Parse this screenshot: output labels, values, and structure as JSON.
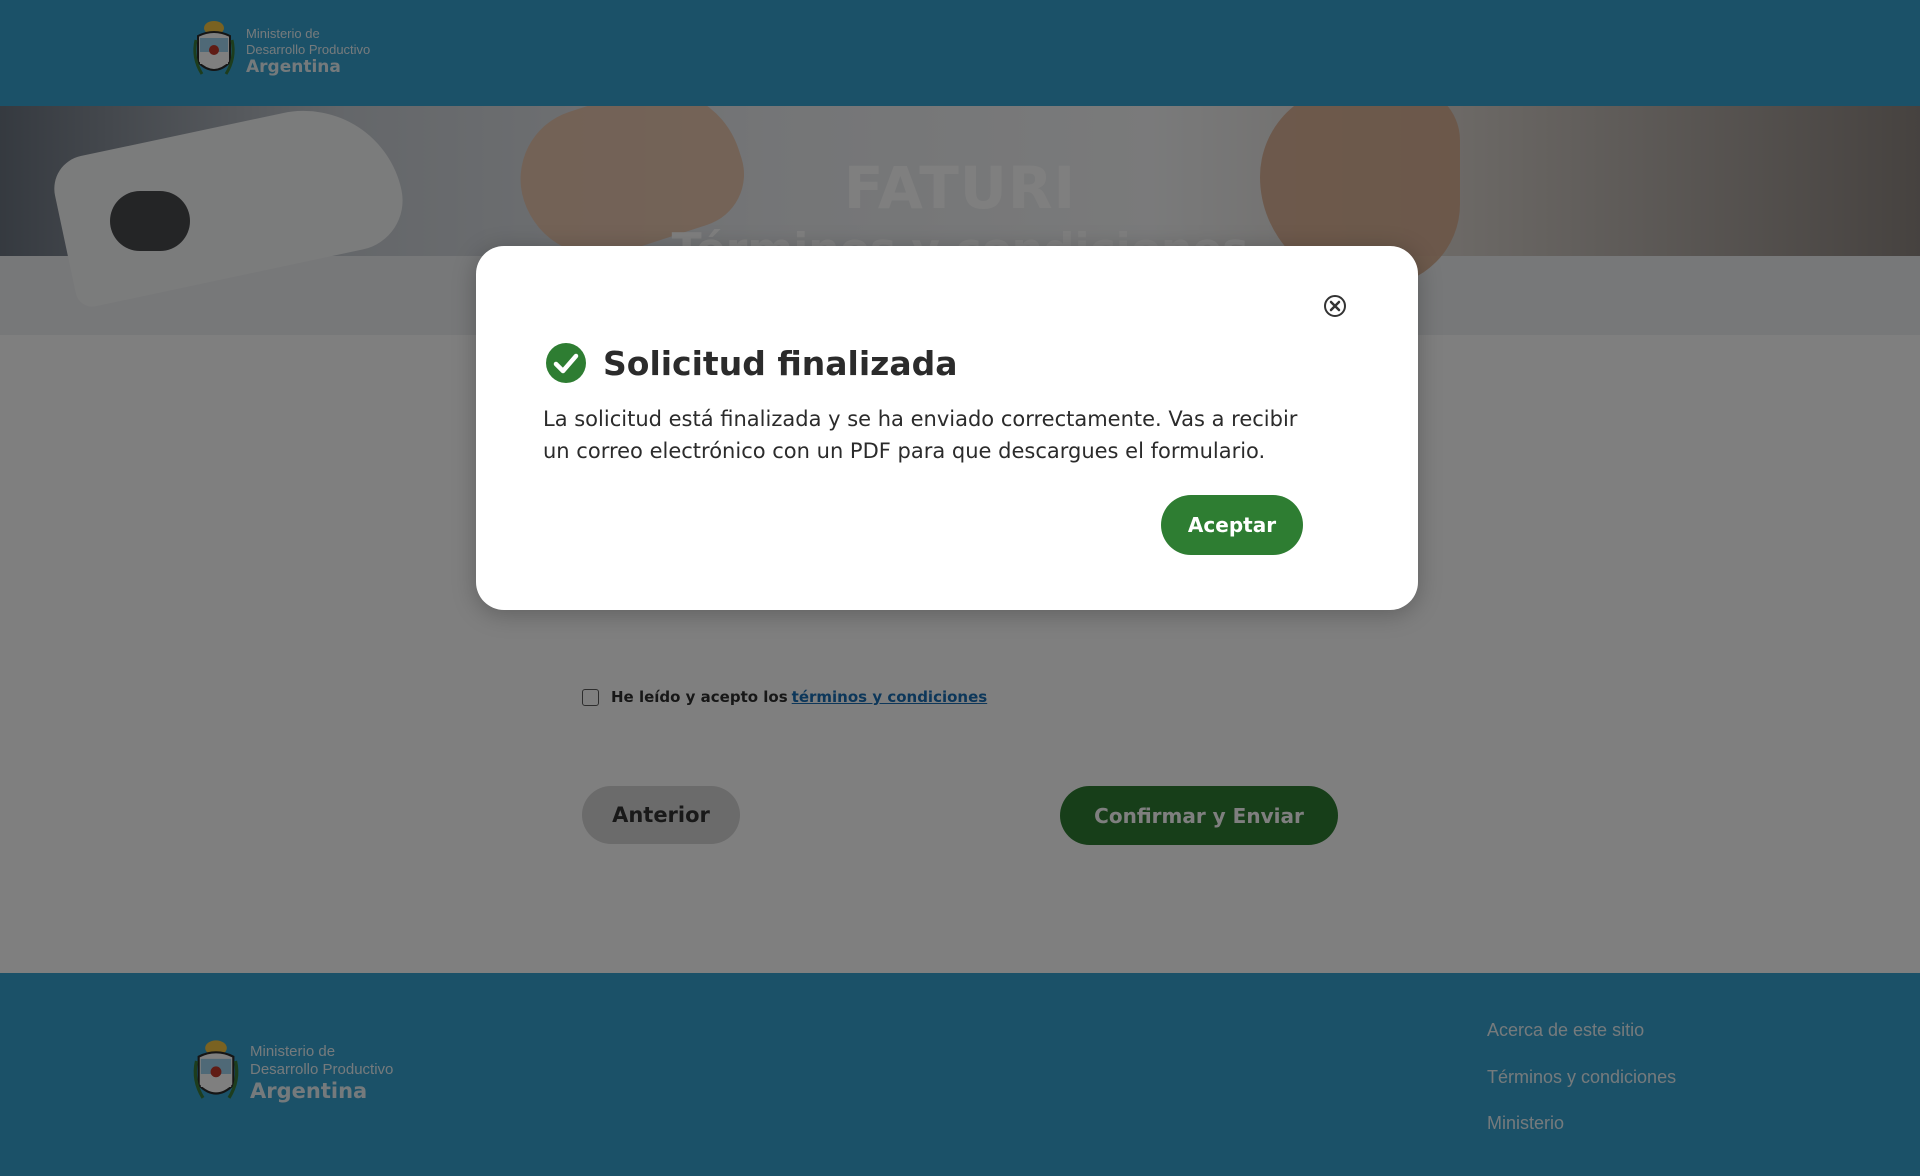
{
  "header": {
    "logo_line1": "Ministerio de",
    "logo_line2": "Desarrollo Productivo",
    "logo_line3": "Argentina"
  },
  "hero": {
    "title": "FATURI",
    "subtitle": "Términos y condiciones"
  },
  "form": {
    "terms_text": "He leído y acepto los",
    "terms_link": "términos y condiciones",
    "checkbox_checked": false,
    "prev_button": "Anterior",
    "confirm_button": "Confirmar y Enviar"
  },
  "footer": {
    "logo_line1": "Ministerio de",
    "logo_line2": "Desarrollo Productivo",
    "logo_line3": "Argentina",
    "links": [
      "Acerca de este sitio",
      "Términos y condiciones",
      "Ministerio"
    ]
  },
  "modal": {
    "title": "Solicitud finalizada",
    "message": "La solicitud está finalizada y se ha enviado correctamente. Vas a recibir un correo electrónico con un PDF para que descargues el formulario.",
    "accept_button": "Aceptar",
    "icon": "check-circle-icon",
    "close_icon": "close-circle-icon"
  },
  "colors": {
    "header_bg": "#36a3d0",
    "primary_green": "#2e7d32",
    "link_blue": "#1a6fb5",
    "overlay": "rgba(0,0,0,0.5)"
  }
}
